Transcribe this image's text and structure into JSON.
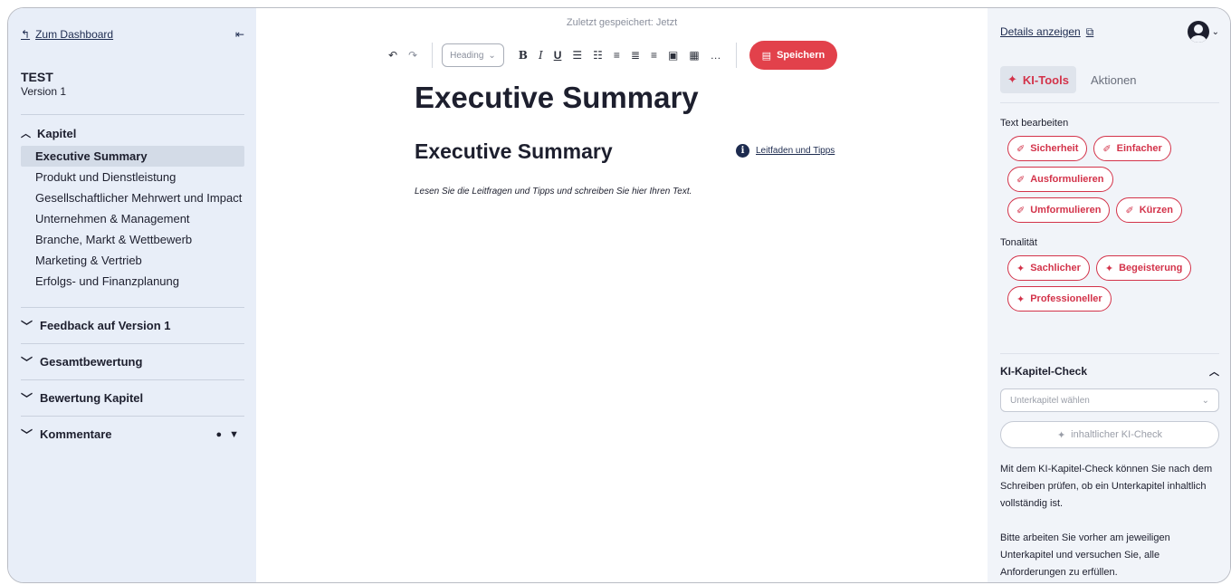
{
  "sidebar": {
    "back_label": "Zum Dashboard",
    "project_title": "TEST",
    "version": "Version 1",
    "chapters_heading": "Kapitel",
    "chapters": [
      "Executive Summary",
      "Produkt und Dienstleistung",
      "Gesellschaftlicher Mehrwert und Impact",
      "Unternehmen & Management",
      "Branche, Markt & Wettbewerb",
      "Marketing & Vertrieb",
      "Erfolgs- und Finanzplanung"
    ],
    "active_chapter": "Executive Summary",
    "sections": [
      "Feedback auf Version 1",
      "Gesamtbewertung",
      "Bewertung Kapitel",
      "Kommentare"
    ]
  },
  "editor": {
    "saved_status": "Zuletzt gespeichert: Jetzt",
    "heading_select": "Heading",
    "save_label": "Speichern",
    "doc_title": "Executive Summary",
    "chapter_title": "Executive Summary",
    "guide_link": "Leitfaden und Tipps",
    "placeholder": "Lesen Sie die Leitfragen und Tipps und schreiben Sie hier Ihren Text."
  },
  "right_panel": {
    "details_link": "Details anzeigen",
    "tabs": [
      "KI-Tools",
      "Aktionen"
    ],
    "text_edit_label": "Text bearbeiten",
    "text_edit_chips": [
      "Sicherheit",
      "Einfacher",
      "Ausformulieren",
      "Umformulieren",
      "Kürzen"
    ],
    "tone_label": "Tonalität",
    "tone_chips": [
      "Sachlicher",
      "Begeisterung",
      "Professioneller"
    ],
    "check_heading": "KI-Kapitel-Check",
    "sub_select_placeholder": "Unterkapitel wählen",
    "check_button": "inhaltlicher KI-Check",
    "info_p1": "Mit dem KI-Kapitel-Check können Sie nach dem Schreiben prüfen, ob ein Unterkapitel inhaltlich vollständig ist.",
    "info_p2": "Bitte arbeiten Sie vorher am jeweiligen Unterkapitel und versuchen Sie, alle Anforderungen zu erfüllen."
  },
  "colors": {
    "accent": "#e2414b",
    "sidebar_bg": "#e8eef8",
    "navy": "#1d2b4f"
  }
}
